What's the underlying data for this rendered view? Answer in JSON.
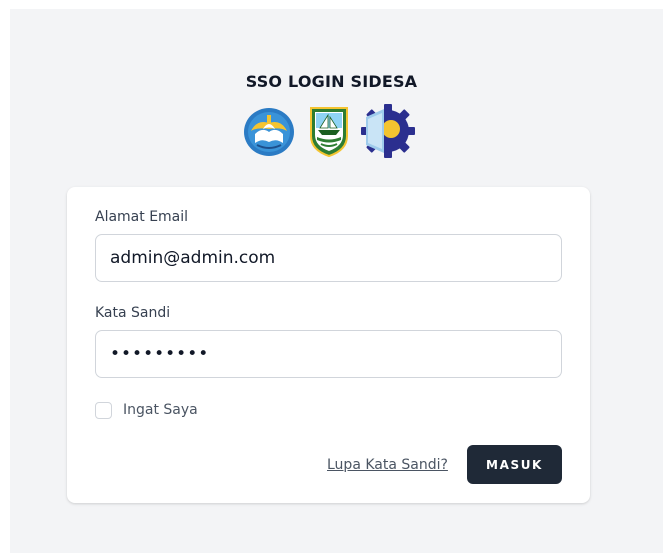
{
  "page": {
    "title": "SSO LOGIN SIDESA"
  },
  "logos": [
    {
      "name": "tut-wuri-handayani-logo"
    },
    {
      "name": "riau-islands-emblem"
    },
    {
      "name": "gear-logo"
    }
  ],
  "form": {
    "email_label": "Alamat Email",
    "email_value": "admin@admin.com",
    "password_label": "Kata Sandi",
    "password_value": "abcdefghi",
    "remember_label": "Ingat Saya",
    "remember_checked": false,
    "forgot_link": "Lupa Kata Sandi?",
    "submit_label": "MASUK"
  },
  "colors": {
    "background": "#f3f4f6",
    "card": "#ffffff",
    "button": "#1f2937",
    "text": "#111827"
  }
}
